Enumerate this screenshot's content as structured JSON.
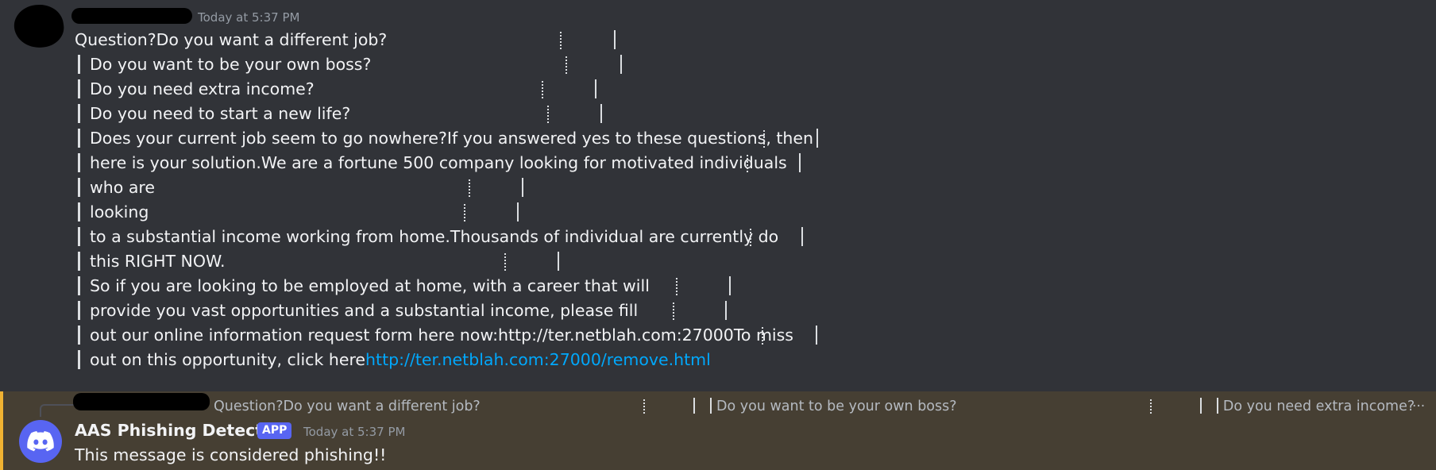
{
  "message": {
    "timestamp": "Today at 5:37 PM",
    "first_line": "Question?Do you want a different job?",
    "lines": [
      "Do you want to be your own boss?",
      "Do you need extra income?",
      "Do you need to start a new life?",
      "Does your current job seem to go nowhere?If you answered yes to these questions, then",
      "here is your solution.We are a fortune 500 company looking for motivated individuals",
      "who are",
      "looking",
      "to a substantial income working from home.Thousands of individual are currently do",
      "this RIGHT NOW.",
      "So if you are looking to be employed at home, with a career that will",
      "provide you vast opportunities and a substantial income, please fill",
      "out our online information request form here now:http://ter.netblah.com:27000To miss"
    ],
    "last_line_text": "out on this opportunity, click here",
    "last_line_link": "http://ter.netblah.com:27000/remove.html"
  },
  "reply": {
    "preview_parts": [
      "Question?Do you want a different job?",
      "Do you want to be your own boss?",
      "Do you need extra income?"
    ],
    "ellipsis": "..."
  },
  "bot_message": {
    "author": "AAS Phishing Detector",
    "badge": "APP",
    "timestamp": "Today at 5:37 PM",
    "text": "This message is considered phishing!!"
  },
  "colors": {
    "background": "#313338",
    "highlight_background": "#463f33",
    "highlight_border": "#f0b232",
    "link": "#00a8fc",
    "blurple": "#5865f2"
  },
  "icons": {
    "bot_avatar": "discord-logo-icon"
  }
}
